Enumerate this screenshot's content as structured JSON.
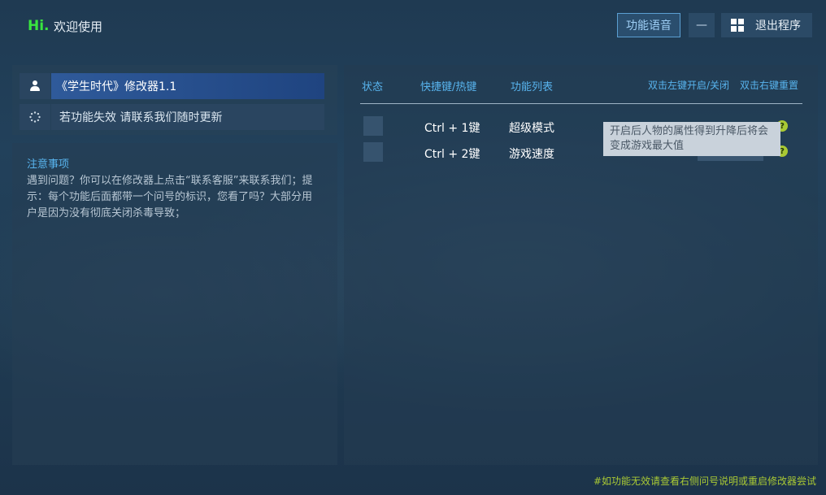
{
  "header": {
    "hi": "Hi.",
    "welcome": "欢迎使用",
    "voice_button": "功能语音",
    "minimize_label": "—",
    "exit_label": "退出程序"
  },
  "sidebar": {
    "title": "《学生时代》修改器1.1",
    "notice": "若功能失效  请联系我们随时更新",
    "notes_title": "注意事项",
    "notes_text": "遇到问题？你可以在修改器上点击“联系客服”来联系我们；提示：每个功能后面都带一个问号的标识，您看了吗？大部分用户是因为没有彻底关闭杀毒导致；"
  },
  "table": {
    "headers": {
      "status": "状态",
      "hotkey": "快捷键/热键",
      "features": "功能列表"
    },
    "hints": {
      "left": "双击左键开启/关闭",
      "right": "双击右键重置"
    },
    "rows": [
      {
        "hotkey": "Ctrl  +  1键",
        "feature": "超级模式",
        "help": "?"
      },
      {
        "hotkey": "Ctrl  +  2键",
        "feature": "游戏速度",
        "help": "?"
      }
    ],
    "tooltip": "开启后人物的属性得到升降后将会变成游戏最大值"
  },
  "footer": "#如功能无效请查看右侧问号说明或重启修改器尝试",
  "colors": {
    "accent_blue": "#58b4ee",
    "hi_green": "#39e63f",
    "footer_green": "#a9c934",
    "title_bar": "#2f5a9a"
  },
  "icons": {
    "user": "user-icon",
    "spinner": "loading-spinner-icon",
    "windows": "windows-logo-icon",
    "help": "question-mark-icon"
  }
}
